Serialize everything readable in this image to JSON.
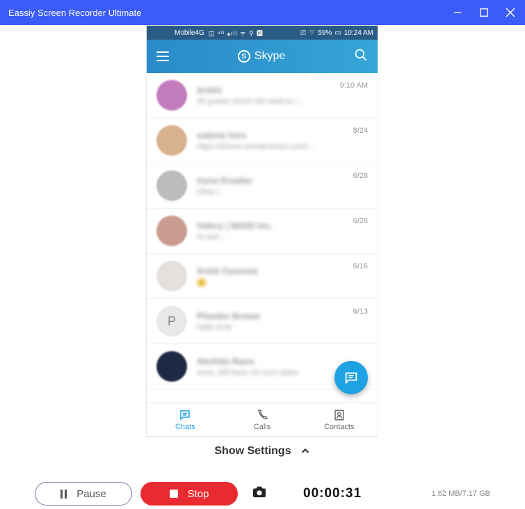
{
  "window": {
    "title": "Eassiy Screen Recorder Ultimate"
  },
  "phone": {
    "status": {
      "carrier": "Mobile4G",
      "battery": "59%",
      "time": "10:24 AM"
    },
    "app": {
      "name": "Skype"
    },
    "nav": {
      "chats": "Chats",
      "calls": "Calls",
      "contacts": "Contacts"
    },
    "chats": [
      {
        "name": "Ankhi",
        "preview": "All guides which still need to r…",
        "date": "9:10 AM",
        "av": "#c27bbd"
      },
      {
        "name": "sabina herz",
        "preview": "https://drfone.wondershare.com/i…",
        "date": "8/24",
        "av": "#d8b28e"
      },
      {
        "name": "Iryna Evadav",
        "preview": "Okay )",
        "date": "6/28",
        "av": "#bcbcbc"
      },
      {
        "name": "Valery | MGID Inc.",
        "preview": "Hi and …",
        "date": "6/28",
        "av": "#c99c8f"
      },
      {
        "name": "Ankit Oyeonia",
        "preview": "😊",
        "date": "6/16",
        "av": "#e6e0dd"
      },
      {
        "name": "Phoebe Brown",
        "preview": "Hello Emil",
        "date": "6/13",
        "av": "#e8e8e8",
        "letter": "P"
      },
      {
        "name": "Akshita Rana",
        "preview": "sorry, still have not such tasks",
        "date": "",
        "av": "#1e2a44"
      }
    ]
  },
  "settings": {
    "label": "Show Settings"
  },
  "recorder": {
    "pause": "Pause",
    "stop": "Stop",
    "timer": "00:00:31",
    "disk": "1.62 MB/7.17 GB"
  }
}
